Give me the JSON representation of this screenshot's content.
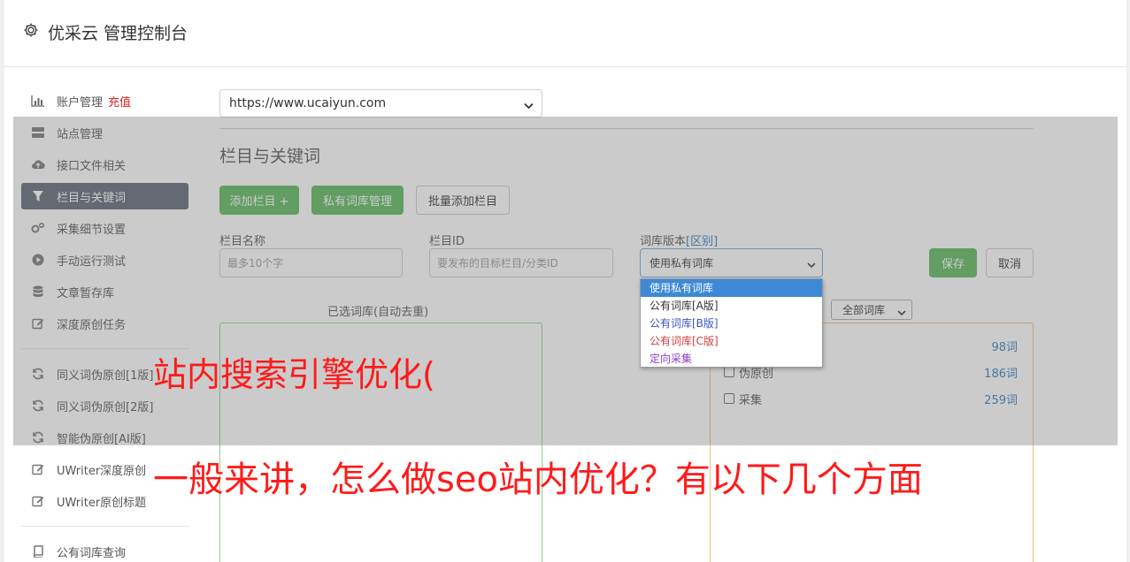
{
  "app": {
    "title": "优采云 管理控制台"
  },
  "sidebar": {
    "items": [
      {
        "label": "账户管理",
        "badge": "充值",
        "icon": "bar-chart-icon"
      },
      {
        "label": "站点管理",
        "icon": "server-icon"
      },
      {
        "label": "接口文件相关",
        "icon": "cloud-upload-icon"
      },
      {
        "label": "栏目与关键词",
        "icon": "filter-icon",
        "active": true
      },
      {
        "label": "采集细节设置",
        "icon": "gears-icon"
      },
      {
        "label": "手动运行测试",
        "icon": "play-circle-icon"
      },
      {
        "label": "文章暂存库",
        "icon": "database-icon"
      },
      {
        "label": "深度原创任务",
        "icon": "edit-icon"
      },
      {
        "label": "同义词伪原创[1版]",
        "icon": "refresh-icon"
      },
      {
        "label": "同义词伪原创[2版]",
        "icon": "refresh-icon"
      },
      {
        "label": "智能伪原创[AI版]",
        "icon": "refresh-icon"
      },
      {
        "label": "UWriter深度原创",
        "icon": "edit-icon"
      },
      {
        "label": "UWriter原创标题",
        "icon": "edit-icon"
      },
      {
        "label": "公有词库查询",
        "icon": "book-icon"
      }
    ]
  },
  "main": {
    "site_select": {
      "value": "https://www.ucaiyun.com"
    },
    "section_title": "栏目与关键词",
    "buttons": {
      "add_column": "添加栏目 +",
      "private_lib": "私有词库管理",
      "batch_add": "批量添加栏目",
      "save": "保存",
      "cancel": "取消"
    },
    "form": {
      "column_name_label": "栏目名称",
      "column_name_placeholder": "最多10个字",
      "column_id_label": "栏目ID",
      "column_id_placeholder": "要发布的目标栏目/分类ID",
      "lib_version_label": "词库版本",
      "lib_version_link": "[区别]",
      "lib_version_value": "使用私有词库",
      "lib_version_options": [
        {
          "label": "使用私有词库",
          "color": "#ffffff"
        },
        {
          "label": "公有词库[A版]",
          "color": "#333333"
        },
        {
          "label": "公有词库[B版]",
          "color": "#3b55c8"
        },
        {
          "label": "公有词库[C版]",
          "color": "#d04040"
        },
        {
          "label": "定向采集",
          "color": "#8a3fc8"
        }
      ]
    },
    "selected_lib_title": "已选词库(自动去重)",
    "all_lib_select": "全部词库",
    "lib_list": [
      {
        "label": "",
        "count": "98词"
      },
      {
        "label": "伪原创",
        "count": "186词"
      },
      {
        "label": "采集",
        "count": "259词"
      }
    ]
  },
  "overlay_text": {
    "line1": "站内搜索引擎优化(",
    "line2": "一般来讲，怎么做seo站内优化？有以下几个方面"
  }
}
